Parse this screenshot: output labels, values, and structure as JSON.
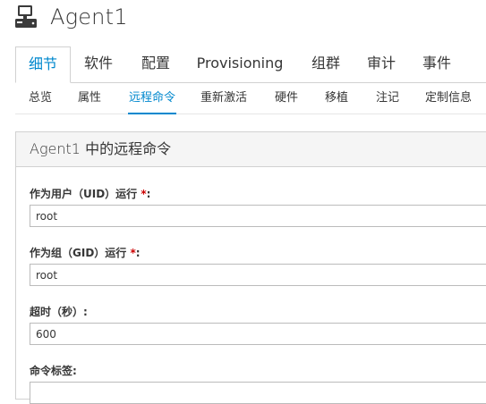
{
  "header": {
    "icon": "system-server-icon",
    "title": "Agent1"
  },
  "tabs": [
    {
      "label": "细节",
      "active": true
    },
    {
      "label": "软件"
    },
    {
      "label": "配置"
    },
    {
      "label": "Provisioning"
    },
    {
      "label": "组群"
    },
    {
      "label": "审计"
    },
    {
      "label": "事件"
    }
  ],
  "subtabs": [
    {
      "label": "总览"
    },
    {
      "label": "属性"
    },
    {
      "label": "远程命令",
      "active": true
    },
    {
      "label": "重新激活"
    },
    {
      "label": "硬件"
    },
    {
      "label": "移植"
    },
    {
      "label": "注记"
    },
    {
      "label": "定制信息"
    }
  ],
  "panel": {
    "title": "Agent1 中的远程命令",
    "fields": {
      "user": {
        "label": "作为用户（UID）运行",
        "required": "*",
        "colon": ":",
        "value": "root"
      },
      "group": {
        "label": "作为组（GID）运行",
        "required": "*",
        "colon": ":",
        "value": "root"
      },
      "timeout": {
        "label": "超时（秒）:",
        "value": "600"
      },
      "command_label": {
        "label": "命令标签:",
        "value": ""
      }
    }
  },
  "colors": {
    "accent": "#0088ce",
    "required": "#cc0000",
    "border": "#d1d1d1",
    "panel_heading_bg": "#f5f5f5"
  }
}
